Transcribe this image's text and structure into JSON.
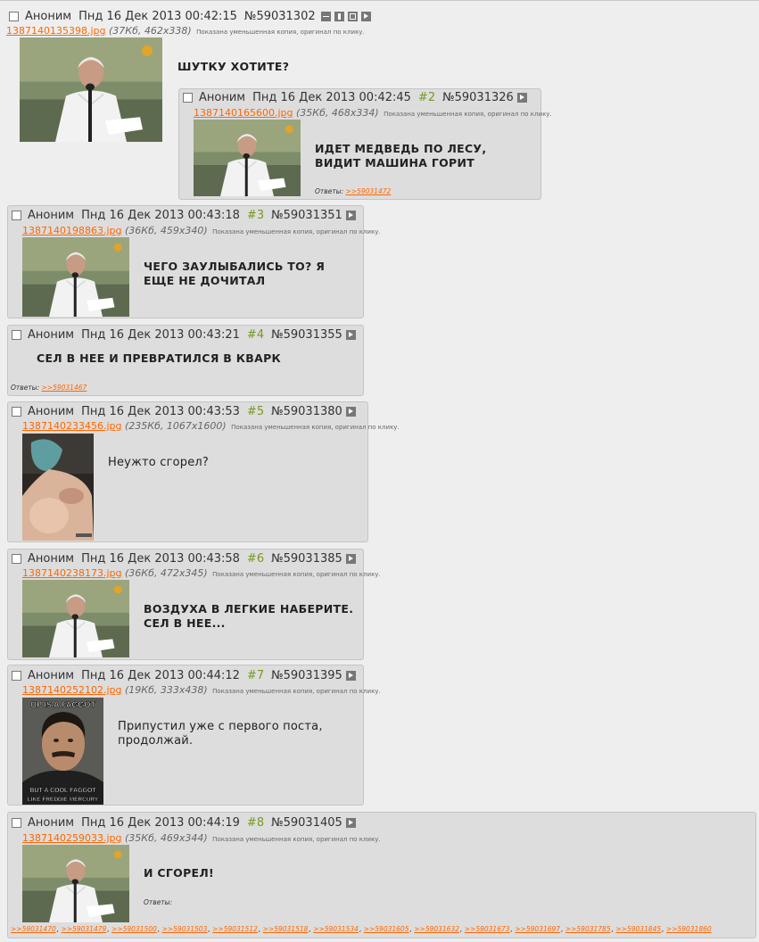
{
  "op": {
    "name": "Аноним",
    "date": "Пнд 16 Дек 2013 00:42:15",
    "number": "№59031302",
    "file_link": "1387140135398.jpg",
    "file_meta": "(37Кб, 462x338)",
    "note": "Показана уменьшенная копия, оригинал по клику.",
    "message": "ШУТКУ ХОТИТЕ?",
    "icons": [
      "minus-icon",
      "updown-icon",
      "square-icon",
      "play-icon"
    ]
  },
  "replies": [
    {
      "name": "Аноним",
      "date": "Пнд 16 Дек 2013 00:42:45",
      "order": "#2",
      "number": "№59031326",
      "file_link": "1387140165600.jpg",
      "file_meta": "(35Кб, 468x334)",
      "note": "Показана уменьшенная копия, оригинал по клику.",
      "message_lines": [
        "ИДЕТ МЕДВЕДЬ ПО ЛЕСУ,",
        "ВИДИТ МАШИНА ГОРИТ"
      ],
      "answers_label": "Ответы:",
      "answers": [
        ">>59031472"
      ]
    },
    {
      "name": "Аноним",
      "date": "Пнд 16 Дек 2013 00:43:18",
      "order": "#3",
      "number": "№59031351",
      "file_link": "1387140198863.jpg",
      "file_meta": "(36Кб, 459x340)",
      "note": "Показана уменьшенная копия, оригинал по клику.",
      "message_lines": [
        "ЧЕГО ЗАУЛЫБАЛИСЬ ТО? Я",
        "ЕЩЕ НЕ ДОЧИТАЛ"
      ]
    },
    {
      "name": "Аноним",
      "date": "Пнд 16 Дек 2013 00:43:21",
      "order": "#4",
      "number": "№59031355",
      "message_lines": [
        "СЕЛ В НЕЕ И ПРЕВРАТИЛСЯ В КВАРК"
      ],
      "answers_label": "Ответы:",
      "answers": [
        ">>59031467"
      ]
    },
    {
      "name": "Аноним",
      "date": "Пнд 16 Дек 2013 00:43:53",
      "order": "#5",
      "number": "№59031380",
      "file_link": "1387140233456.jpg",
      "file_meta": "(235Кб, 1067x1600)",
      "note": "Показана уменьшенная копия, оригинал по клику.",
      "message_lines": [
        "Неужто сгорел?"
      ]
    },
    {
      "name": "Аноним",
      "date": "Пнд 16 Дек 2013 00:43:58",
      "order": "#6",
      "number": "№59031385",
      "file_link": "1387140238173.jpg",
      "file_meta": "(36Кб, 472x345)",
      "note": "Показана уменьшенная копия, оригинал по клику.",
      "message_lines": [
        "ВОЗДУХА В ЛЕГКИЕ НАБЕРИТЕ.",
        "СЕЛ В НЕЕ..."
      ]
    },
    {
      "name": "Аноним",
      "date": "Пнд 16 Дек 2013 00:44:12",
      "order": "#7",
      "number": "№59031395",
      "file_link": "1387140252102.jpg",
      "file_meta": "(19Кб, 333x438)",
      "note": "Показана уменьшенная копия, оригинал по клику.",
      "message_lines": [
        "Припустил уже с первого поста,",
        "продолжай."
      ],
      "image_caption_top": "OP IS A FAGGOT",
      "image_caption_bottom_1": "BUT A COOL FAGGOT",
      "image_caption_bottom_2": "LIKE FREDDIE MERCURY"
    },
    {
      "name": "Аноним",
      "date": "Пнд 16 Дек 2013 00:44:19",
      "order": "#8",
      "number": "№59031405",
      "file_link": "1387140259033.jpg",
      "file_meta": "(35Кб, 469x344)",
      "note": "Показана уменьшенная копия, оригинал по клику.",
      "message_lines": [
        "И СГОРЕЛ!"
      ],
      "answers_label": "Ответы:",
      "answers": [
        ">>59031470",
        ">>59031479",
        ">>59031500",
        ">>59031503",
        ">>59031512",
        ">>59031518",
        ">>59031534",
        ">>59031605",
        ">>59031632",
        ">>59031673",
        ">>59031697",
        ">>59031785",
        ">>59031845",
        ">>59031860"
      ]
    }
  ]
}
